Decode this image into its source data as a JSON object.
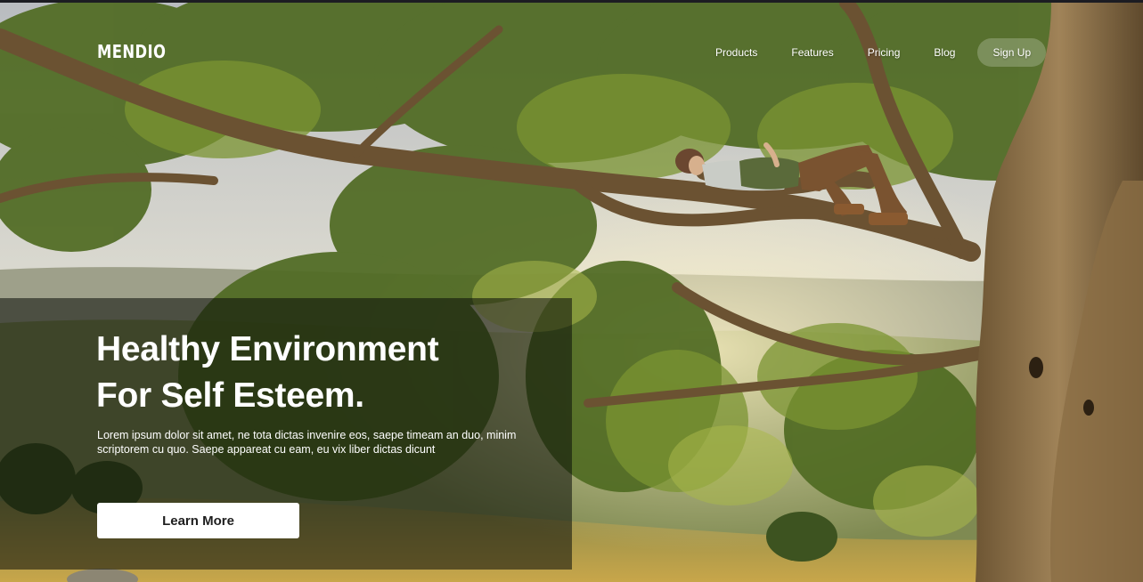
{
  "brand": {
    "logo": "MENDIO"
  },
  "nav": {
    "items": [
      "Products",
      "Features",
      "Pricing",
      "Blog"
    ],
    "signup_label": "Sign Up"
  },
  "hero": {
    "title_line1": "Healthy Environment",
    "title_line2": "For Self Esteem.",
    "body": "Lorem ipsum dolor sit amet, ne tota dictas invenire eos, saepe timeam an duo, minim scriptorem cu quo. Saepe appareat cu eam, eu vix liber dictas dicunt",
    "cta_label": "Learn More"
  },
  "colors": {
    "text": "#ffffff",
    "button_bg": "#ffffff",
    "button_text": "#1e1e1e",
    "panel_overlay": "rgba(10,12,8,0.55)",
    "page_frame": "#1c1c22"
  }
}
